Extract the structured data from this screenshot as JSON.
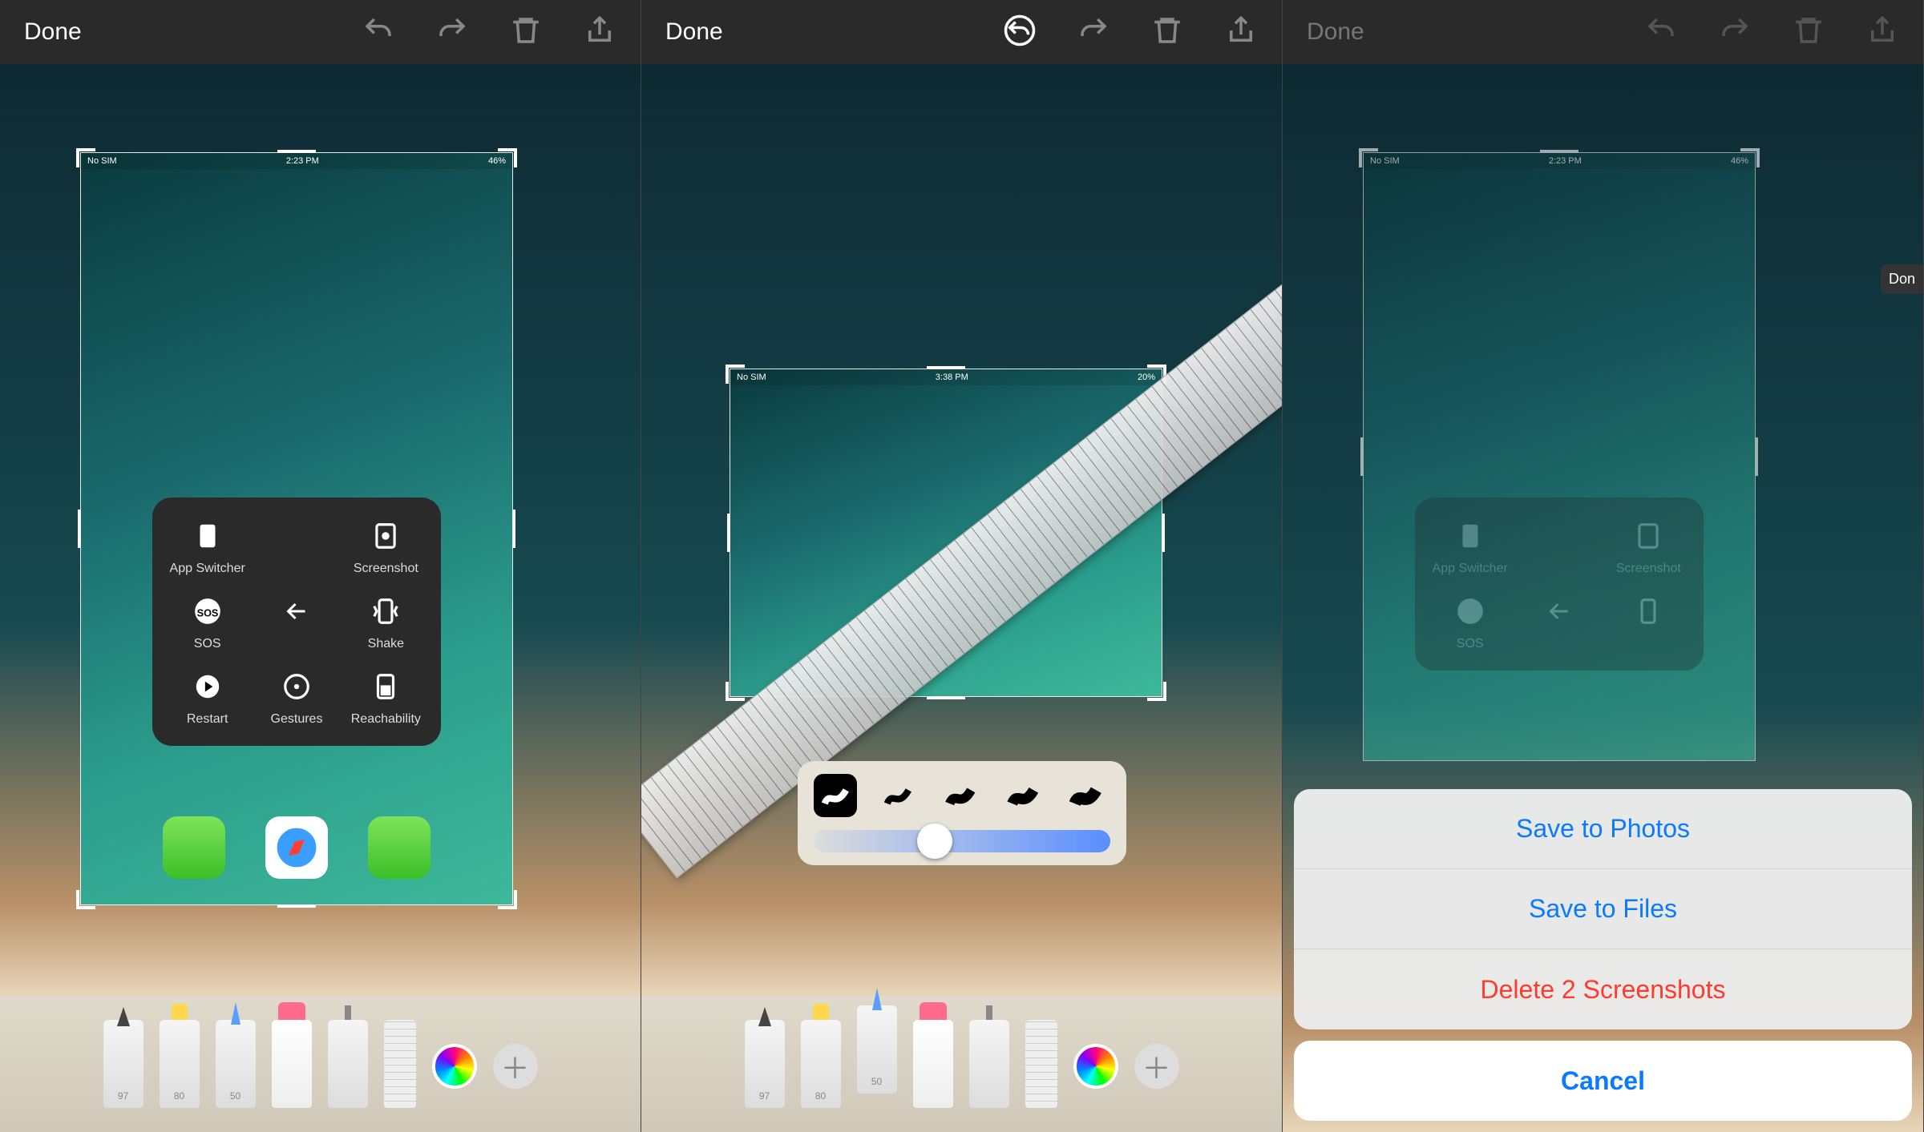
{
  "done_label": "Done",
  "panel1": {
    "statusbar": {
      "carrier": "No SIM",
      "time": "2:23 PM",
      "battery": "46%"
    },
    "at_menu": [
      {
        "label": "App Switcher"
      },
      {
        "label": "Screenshot"
      },
      {
        "label": "SOS"
      },
      {
        "label": ""
      },
      {
        "label": "Shake"
      },
      {
        "label": "Restart"
      },
      {
        "label": "Gestures"
      },
      {
        "label": "Reachability"
      }
    ],
    "tool_nums": [
      "97",
      "80",
      "50",
      "",
      "",
      ""
    ]
  },
  "panel2": {
    "statusbar": {
      "carrier": "No SIM",
      "time": "3:38 PM",
      "battery": "20%"
    },
    "slider_pos": 0.35,
    "tool_nums": [
      "97",
      "80",
      "50",
      "",
      "",
      ""
    ]
  },
  "panel3": {
    "statusbar": {
      "carrier": "No SIM",
      "time": "2:23 PM",
      "battery": "46%"
    },
    "at_menu": [
      {
        "label": "App Switcher"
      },
      {
        "label": "Screenshot"
      },
      {
        "label": "SOS"
      },
      {
        "label": ""
      }
    ],
    "sheet": {
      "save_photos": "Save to Photos",
      "save_files": "Save to Files",
      "delete": "Delete 2 Screenshots",
      "cancel": "Cancel"
    },
    "peek": "Don"
  }
}
